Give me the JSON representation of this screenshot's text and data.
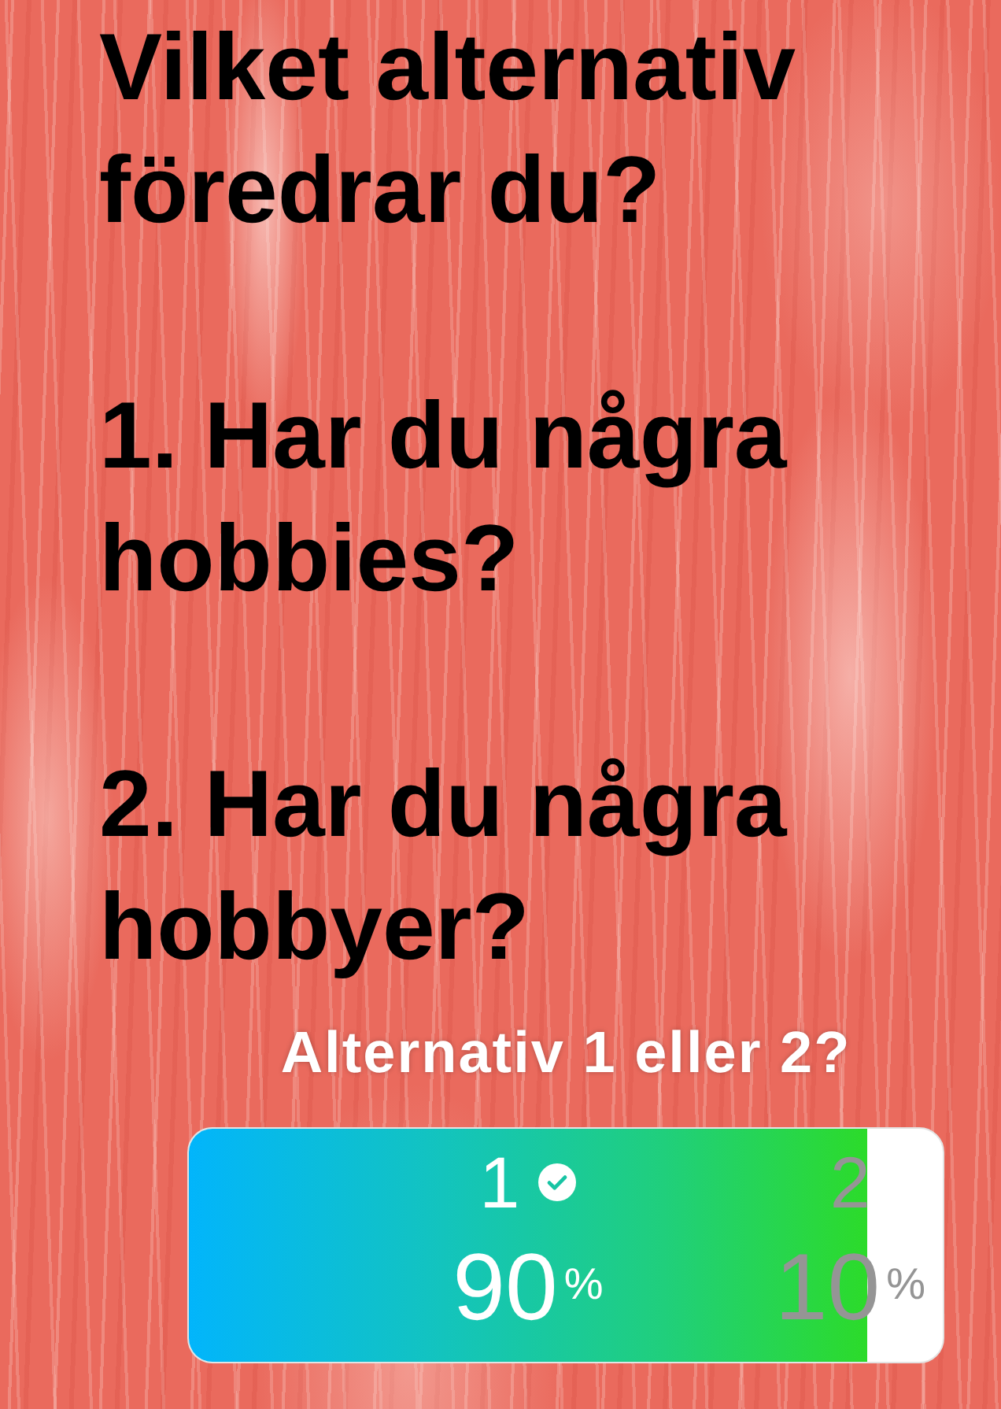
{
  "heading": "Vilket alternativ föredrar du?",
  "statements": [
    "1. Har du några hobbies?",
    "2. Har du några hobbyer?"
  ],
  "poll": {
    "question": "Alternativ 1 eller 2?",
    "bar": {
      "level": 0.9
    },
    "options": [
      {
        "label": "1",
        "value": "90",
        "unit": "%",
        "selected": true
      },
      {
        "label": "2",
        "value": "10",
        "unit": "%",
        "selected": false
      }
    ]
  }
}
